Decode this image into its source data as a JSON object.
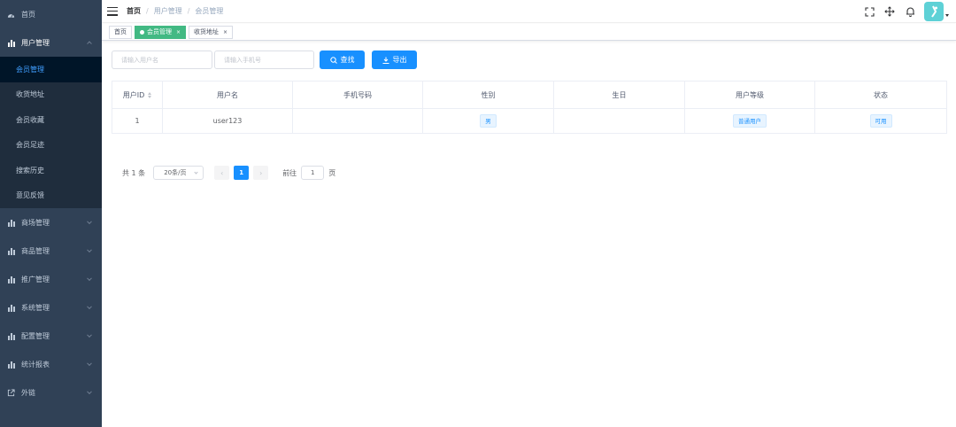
{
  "sidebar": {
    "home": "首页",
    "user_mgmt": "用户管理",
    "sub_items": [
      "会员管理",
      "收货地址",
      "会员收藏",
      "会员足迹",
      "搜索历史",
      "意见反馈"
    ],
    "mall": "商场管理",
    "goods": "商品管理",
    "promo": "推广管理",
    "system": "系统管理",
    "config": "配置管理",
    "stats": "统计报表",
    "external": "外链"
  },
  "navbar": {
    "breadcrumb": [
      "首页",
      "用户管理",
      "会员管理"
    ],
    "separator": "/"
  },
  "tags": {
    "home": "首页",
    "member": "会员管理",
    "address": "收货地址",
    "close": "×"
  },
  "filters": {
    "username_placeholder": "请输入用户名",
    "phone_placeholder": "请输入手机号",
    "search_label": "查找",
    "export_label": "导出"
  },
  "table": {
    "headers": [
      "用户ID",
      "用户名",
      "手机号码",
      "性别",
      "生日",
      "用户等级",
      "状态"
    ],
    "rows": [
      {
        "id": "1",
        "username": "user123",
        "phone": "",
        "gender": "男",
        "birthday": "",
        "level": "普通用户",
        "status": "可用"
      }
    ]
  },
  "pagination": {
    "total": "共 1 条",
    "page_size": "20条/页",
    "prev": "‹",
    "current": "1",
    "next": "›",
    "goto_prefix": "前往",
    "goto_value": "1",
    "goto_suffix": "页"
  },
  "colors": {
    "sidebar_bg": "#304156",
    "submenu_bg": "#1f2d3d",
    "primary": "#1890ff",
    "active_tag": "#42b983"
  }
}
